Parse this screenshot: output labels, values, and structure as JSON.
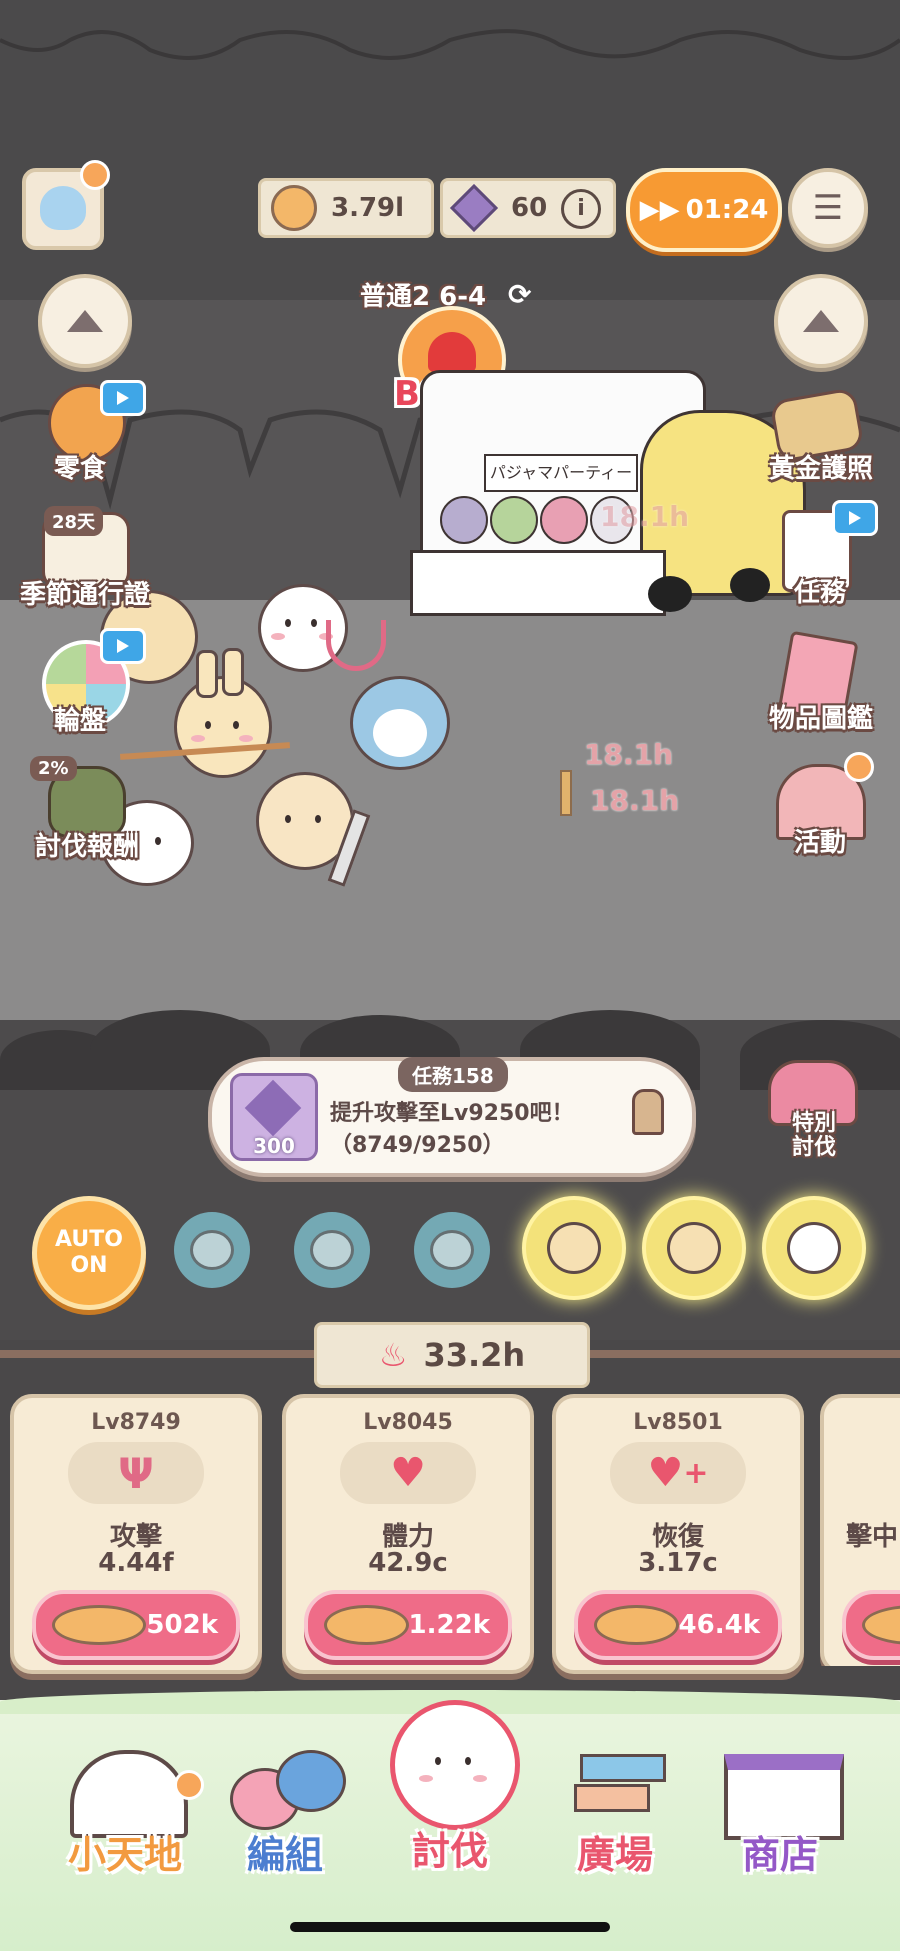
{
  "topbar": {
    "coins": "3.79l",
    "gems": "60",
    "timer": "01:24"
  },
  "stage": {
    "name": "普通2 6-4",
    "boss_label": "BOSS"
  },
  "left_menu": [
    {
      "label": "零食"
    },
    {
      "label": "季節通行證",
      "badge": "28天"
    },
    {
      "label": "輪盤"
    },
    {
      "label": "討伐報酬",
      "badge": "2%"
    }
  ],
  "right_menu": [
    {
      "label": "黃金護照"
    },
    {
      "label": "任務"
    },
    {
      "label": "物品圖鑑"
    },
    {
      "label": "活動"
    }
  ],
  "damage_popups": [
    "18.1h",
    "18.1h",
    "18.1h"
  ],
  "truck_sign": "パジャマパーティーズ",
  "quest": {
    "tag": "任務158",
    "reward": "300",
    "text": "提升攻擊至Lv9250吧！",
    "progress": "（8749/9250）"
  },
  "special_hunt": "特別\n討伐",
  "auto": {
    "line1": "AUTO",
    "line2": "ON"
  },
  "total_time": "33.2h",
  "upgrades": [
    {
      "level": "Lv8749",
      "name": "攻擊",
      "value": "4.44f",
      "cost": "502k",
      "icon": "trident-icon"
    },
    {
      "level": "Lv8045",
      "name": "體力",
      "value": "42.9c",
      "cost": "1.22k",
      "icon": "heart-icon"
    },
    {
      "level": "Lv8501",
      "name": "恢復",
      "value": "3.17c",
      "cost": "46.4k",
      "icon": "heart-plus-icon"
    },
    {
      "level": "",
      "name": "擊中",
      "value": "",
      "cost": "",
      "icon": "partial-card"
    }
  ],
  "nav": [
    {
      "label": "小天地"
    },
    {
      "label": "編組"
    },
    {
      "label": "討伐"
    },
    {
      "label": "廣場"
    },
    {
      "label": "商店"
    }
  ],
  "colors": {
    "accent_orange": "#f79a33",
    "pink_button": "#ef6c88",
    "plank": "#efe6d3"
  }
}
